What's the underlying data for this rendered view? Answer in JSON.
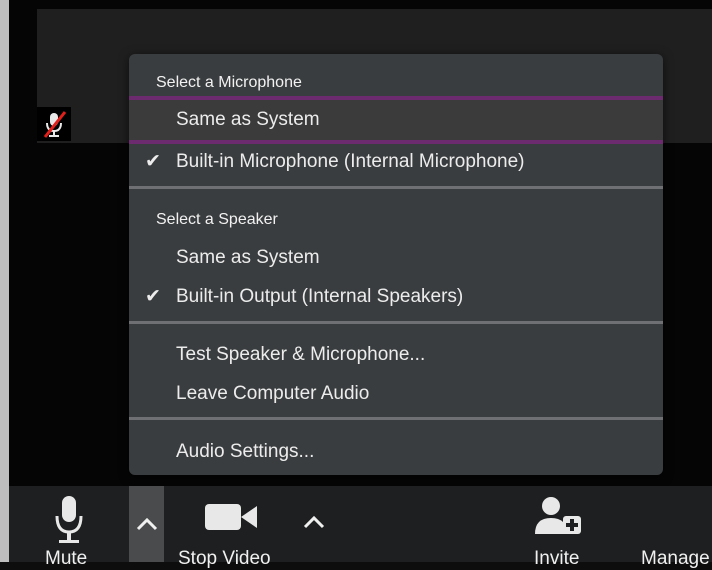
{
  "audio_menu": {
    "microphone_header": "Select a Microphone",
    "microphone_options": [
      {
        "label": "Same as System",
        "checked": false,
        "highlighted": true
      },
      {
        "label": "Built-in Microphone (Internal Microphone)",
        "checked": true,
        "highlighted": false
      }
    ],
    "speaker_header": "Select a Speaker",
    "speaker_options": [
      {
        "label": "Same as System",
        "checked": false
      },
      {
        "label": "Built-in Output (Internal Speakers)",
        "checked": true
      }
    ],
    "test_label": "Test Speaker & Microphone...",
    "leave_label": "Leave Computer Audio",
    "settings_label": "Audio Settings...",
    "check_glyph": "✔"
  },
  "toolbar": {
    "mute_label": "Mute",
    "stop_video_label": "Stop Video",
    "invite_label": "Invite",
    "manage_label": "Manage"
  },
  "colors": {
    "menu_bg": "#3a3d3f",
    "highlight_border": "#6c2b6e",
    "toolbar_bg": "#1e1f20",
    "muted_icon_red": "#e0201b"
  },
  "icons": {
    "mute": "microphone-icon",
    "muted_participant": "muted-microphone-icon",
    "video": "video-camera-icon",
    "invite": "add-participant-icon",
    "caret": "chevron-up-icon"
  }
}
